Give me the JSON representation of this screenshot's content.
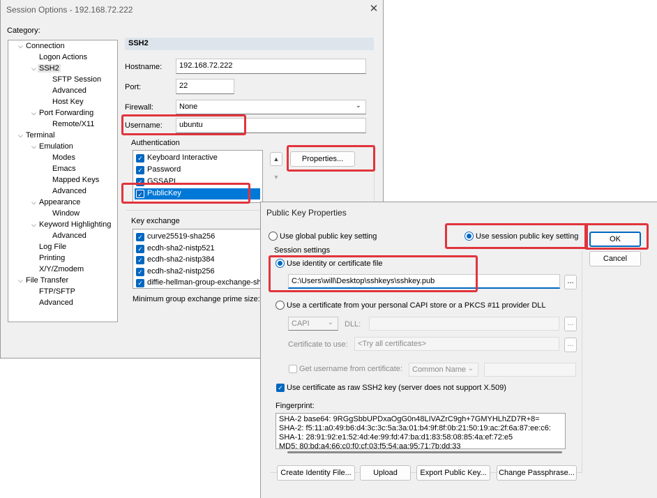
{
  "session_window": {
    "title": "Session Options - 192.168.72.222",
    "category_label": "Category:",
    "tree": [
      {
        "label": "Connection",
        "level": 0,
        "expanded": true
      },
      {
        "label": "Logon Actions",
        "level": 1
      },
      {
        "label": "SSH2",
        "level": 1,
        "expanded": true,
        "selected": true
      },
      {
        "label": "SFTP Session",
        "level": 2
      },
      {
        "label": "Advanced",
        "level": 2
      },
      {
        "label": "Host Key",
        "level": 2
      },
      {
        "label": "Port Forwarding",
        "level": 1,
        "expanded": true
      },
      {
        "label": "Remote/X11",
        "level": 2
      },
      {
        "label": "Terminal",
        "level": 0,
        "expanded": true
      },
      {
        "label": "Emulation",
        "level": 1,
        "expanded": true
      },
      {
        "label": "Modes",
        "level": 2
      },
      {
        "label": "Emacs",
        "level": 2
      },
      {
        "label": "Mapped Keys",
        "level": 2
      },
      {
        "label": "Advanced",
        "level": 2
      },
      {
        "label": "Appearance",
        "level": 1,
        "expanded": true
      },
      {
        "label": "Window",
        "level": 2
      },
      {
        "label": "Keyword Highlighting",
        "level": 1,
        "expanded": true
      },
      {
        "label": "Advanced",
        "level": 2
      },
      {
        "label": "Log File",
        "level": 1
      },
      {
        "label": "Printing",
        "level": 1
      },
      {
        "label": "X/Y/Zmodem",
        "level": 1
      },
      {
        "label": "File Transfer",
        "level": 0,
        "expanded": true
      },
      {
        "label": "FTP/SFTP",
        "level": 1
      },
      {
        "label": "Advanced",
        "level": 1
      }
    ],
    "section_header": "SSH2",
    "hostname_label": "Hostname:",
    "hostname_value": "192.168.72.222",
    "port_label": "Port:",
    "port_value": "22",
    "firewall_label": "Firewall:",
    "firewall_value": "None",
    "username_label": "Username:",
    "username_value": "ubuntu",
    "auth_group_label": "Authentication",
    "auth_methods": [
      {
        "label": "Keyboard Interactive",
        "checked": true
      },
      {
        "label": "Password",
        "checked": true
      },
      {
        "label": "GSSAPI",
        "checked": true
      },
      {
        "label": "PublicKey",
        "checked": true,
        "selected": true
      }
    ],
    "properties_button": "Properties...",
    "kex_group_label": "Key exchange",
    "kex_methods": [
      {
        "label": "curve25519-sha256",
        "checked": true
      },
      {
        "label": "ecdh-sha2-nistp521",
        "checked": true
      },
      {
        "label": "ecdh-sha2-nistp384",
        "checked": true
      },
      {
        "label": "ecdh-sha2-nistp256",
        "checked": true
      },
      {
        "label": "diffie-hellman-group-exchange-sh",
        "checked": true
      }
    ],
    "min_prime_label": "Minimum group exchange prime size:",
    "close_icon": "close-icon"
  },
  "pk_dialog": {
    "title": "Public Key Properties",
    "global_radio_label": "Use global public key setting",
    "session_radio_label": "Use session public key setting",
    "ok_button": "OK",
    "cancel_button": "Cancel",
    "session_settings_label": "Session settings",
    "identity_radio_label": "Use identity or certificate file",
    "identity_path": "C:\\Users\\will\\Desktop\\sshkeys\\sshkey.pub",
    "browse_button": "...",
    "capi_radio_label": "Use a certificate from your personal CAPI store or a PKCS #11 provider DLL",
    "capi_select_value": "CAPI",
    "dll_label": "DLL:",
    "cert_to_use_label": "Certificate to use:",
    "cert_to_use_value": "<Try all certificates>",
    "get_username_label": "Get username from certificate:",
    "common_name_value": "Common Name",
    "raw_ssh2_label": "Use certificate as raw SSH2 key (server does not support X.509)",
    "fingerprint_label": "Fingerprint:",
    "fingerprint_lines": [
      "SHA-2 base64: 9RGgSbbUPDxaOgG0n48LIVAZrC9gh+7GMYHLhZD7R+8=",
      "SHA-2: f5:11:a0:49:b6:d4:3c:3c:5a:3a:01:b4:9f:8f:0b:21:50:19:ac:2f:6a:87:ee:c6:",
      "SHA-1: 28:91:92:e1:52:4d:4e:99:fd:47:ba:d1:83:58:08:85:4a:ef:72:e5",
      "MD5: 80:bd:a4:66:c0:f0:cf:03:f5:54:aa:95:71:7b:dd:33"
    ],
    "create_identity_button": "Create Identity File...",
    "upload_button": "Upload",
    "export_button": "Export Public Key...",
    "change_pass_button": "Change Passphrase..."
  },
  "colors": {
    "accent": "#0067c0",
    "highlight": "#e0343c",
    "selected_row": "#0078d7"
  }
}
